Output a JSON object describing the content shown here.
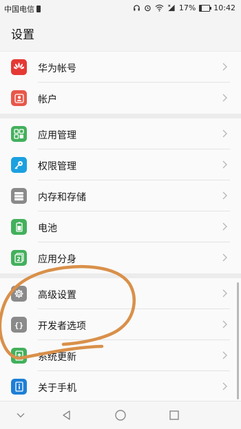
{
  "status_bar": {
    "carrier": "中国电信",
    "battery": "17%",
    "battery_level": 0.17,
    "time": "10:42"
  },
  "header": {
    "title": "设置"
  },
  "groups": [
    {
      "items": [
        {
          "label": "华为帐号",
          "icon": "huawei-logo-icon",
          "color": "#e53935"
        },
        {
          "label": "帐户",
          "icon": "account-icon",
          "color": "#e8574a"
        }
      ]
    },
    {
      "items": [
        {
          "label": "应用管理",
          "icon": "apps-grid-icon",
          "color": "#43b05c"
        },
        {
          "label": "权限管理",
          "icon": "key-icon",
          "color": "#1ba0e0"
        },
        {
          "label": "内存和存储",
          "icon": "storage-icon",
          "color": "#8a8a8a"
        },
        {
          "label": "电池",
          "icon": "battery-icon",
          "color": "#43b05c"
        },
        {
          "label": "应用分身",
          "icon": "app-twin-icon",
          "color": "#43b05c"
        }
      ]
    },
    {
      "items": [
        {
          "label": "高级设置",
          "icon": "gear-icon",
          "color": "#8a8a8a"
        },
        {
          "label": "开发者选项",
          "icon": "braces-icon",
          "color": "#8a8a8a"
        },
        {
          "label": "系统更新",
          "icon": "system-update-icon",
          "color": "#43b05c"
        },
        {
          "label": "关于手机",
          "icon": "phone-info-icon",
          "color": "#1e7fd6"
        }
      ]
    }
  ],
  "nav": {
    "buttons": [
      "chevron-down-icon",
      "back-icon",
      "home-icon",
      "recents-icon"
    ]
  },
  "annotation_color": "#d9904a"
}
